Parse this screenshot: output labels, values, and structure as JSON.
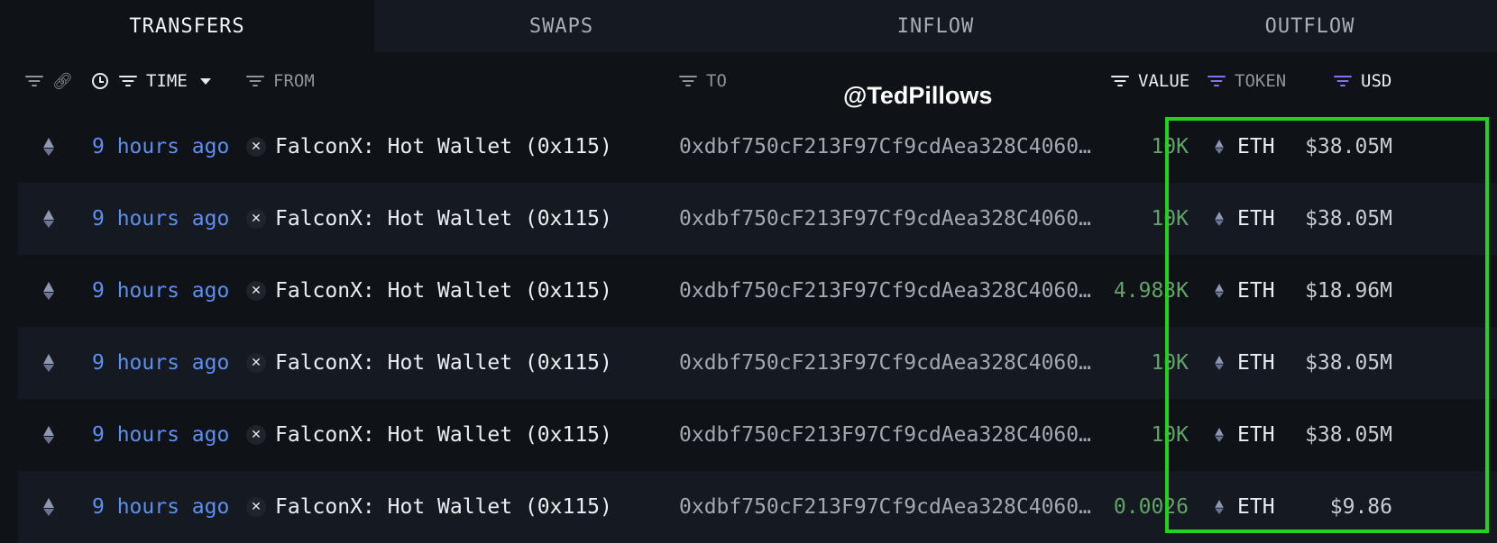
{
  "tabs": [
    "TRANSFERS",
    "SWAPS",
    "INFLOW",
    "OUTFLOW"
  ],
  "active_tab": "TRANSFERS",
  "columns": {
    "time": "TIME",
    "from": "FROM",
    "to": "TO",
    "value": "VALUE",
    "token": "TOKEN",
    "usd": "USD"
  },
  "watermark": "@TedPillows",
  "rows": [
    {
      "time": "9 hours ago",
      "from": "FalconX: Hot Wallet (0x115)",
      "to": "0xdbf750cF213F97Cf9cdAea328C4060…",
      "value": "10K",
      "token": "ETH",
      "usd": "$38.05M"
    },
    {
      "time": "9 hours ago",
      "from": "FalconX: Hot Wallet (0x115)",
      "to": "0xdbf750cF213F97Cf9cdAea328C4060…",
      "value": "10K",
      "token": "ETH",
      "usd": "$38.05M"
    },
    {
      "time": "9 hours ago",
      "from": "FalconX: Hot Wallet (0x115)",
      "to": "0xdbf750cF213F97Cf9cdAea328C4060…",
      "value": "4.983K",
      "token": "ETH",
      "usd": "$18.96M"
    },
    {
      "time": "9 hours ago",
      "from": "FalconX: Hot Wallet (0x115)",
      "to": "0xdbf750cF213F97Cf9cdAea328C4060…",
      "value": "10K",
      "token": "ETH",
      "usd": "$38.05M"
    },
    {
      "time": "9 hours ago",
      "from": "FalconX: Hot Wallet (0x115)",
      "to": "0xdbf750cF213F97Cf9cdAea328C4060…",
      "value": "10K",
      "token": "ETH",
      "usd": "$38.05M"
    },
    {
      "time": "9 hours ago",
      "from": "FalconX: Hot Wallet (0x115)",
      "to": "0xdbf750cF213F97Cf9cdAea328C4060…",
      "value": "0.0026",
      "token": "ETH",
      "usd": "$9.86"
    }
  ],
  "icons": {
    "chain": "ethereum-icon",
    "entity": "falconx-icon",
    "filter": "filter-icon",
    "link": "link-icon",
    "clock": "clock-icon"
  },
  "colors": {
    "accent_time": "#5b8ff0",
    "value_green": "#62a368",
    "filter_purple": "#8b6ff0",
    "highlight_box": "#22d21f"
  }
}
